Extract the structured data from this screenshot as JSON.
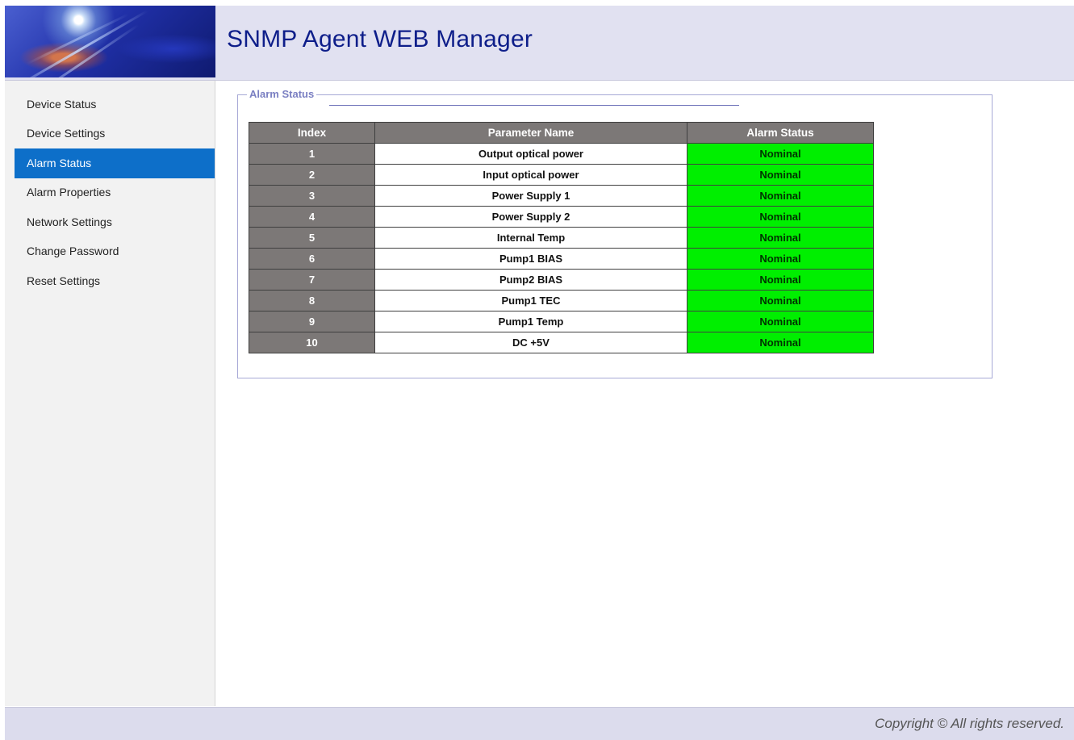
{
  "header": {
    "title": "SNMP Agent WEB Manager"
  },
  "sidebar": {
    "items": [
      {
        "label": "Device Status"
      },
      {
        "label": "Device Settings"
      },
      {
        "label": "Alarm Status",
        "active": true
      },
      {
        "label": "Alarm Properties"
      },
      {
        "label": "Network Settings"
      },
      {
        "label": "Change Password"
      },
      {
        "label": "Reset Settings"
      }
    ]
  },
  "main": {
    "legend": "Alarm Status",
    "table": {
      "headers": [
        "Index",
        "Parameter Name",
        "Alarm Status"
      ],
      "rows": [
        {
          "index": "1",
          "name": "Output optical power",
          "status": "Nominal"
        },
        {
          "index": "2",
          "name": "Input optical power",
          "status": "Nominal"
        },
        {
          "index": "3",
          "name": "Power Supply 1",
          "status": "Nominal"
        },
        {
          "index": "4",
          "name": "Power Supply 2",
          "status": "Nominal"
        },
        {
          "index": "5",
          "name": "Internal Temp",
          "status": "Nominal"
        },
        {
          "index": "6",
          "name": "Pump1 BIAS",
          "status": "Nominal"
        },
        {
          "index": "7",
          "name": "Pump2 BIAS",
          "status": "Nominal"
        },
        {
          "index": "8",
          "name": "Pump1 TEC",
          "status": "Nominal"
        },
        {
          "index": "9",
          "name": "Pump1 Temp",
          "status": "Nominal"
        },
        {
          "index": "10",
          "name": "DC +5V",
          "status": "Nominal"
        }
      ]
    }
  },
  "footer": {
    "copyright": "Copyright © All rights reserved."
  },
  "colors": {
    "title": "#0e1e8a",
    "active_nav": "#0d6fc9",
    "status_nominal": "#00ef00",
    "table_header": "#7c7877",
    "legend": "#7a7fc2"
  }
}
